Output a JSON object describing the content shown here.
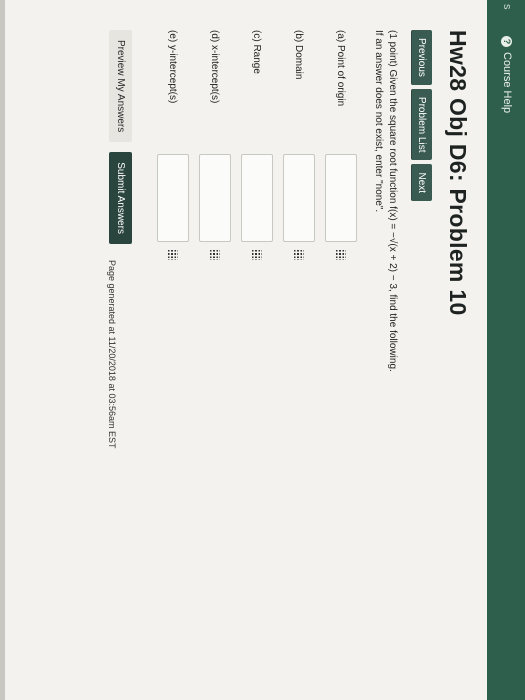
{
  "header": {
    "crumb": "s",
    "help_label": "Course Help"
  },
  "page": {
    "title": "Hw28 Obj D6: Problem 10",
    "nav": [
      "Previous",
      "Problem List",
      "Next"
    ]
  },
  "problem": {
    "line1": "(1 point) Given the square root function f(x) = −√(x + 2) − 3, find the following.",
    "line2": "If an answer does not exist, enter \"none\".",
    "parts": [
      {
        "label": "(a) Point of origin",
        "value": ""
      },
      {
        "label": "(b) Domain",
        "value": ""
      },
      {
        "label": "(c) Range",
        "value": ""
      },
      {
        "label": "(d) x-intercept(s)",
        "value": ""
      },
      {
        "label": "(e) y-intercept(s)",
        "value": ""
      }
    ]
  },
  "actions": {
    "preview": "Preview My Answers",
    "submit": "Submit Answers"
  },
  "footer": "Page generated at 11/20/2018 at 03:56am EST",
  "colors": {
    "topbar": "#2e5e4c",
    "button": "#3a5b52",
    "submit": "#2a453e"
  }
}
